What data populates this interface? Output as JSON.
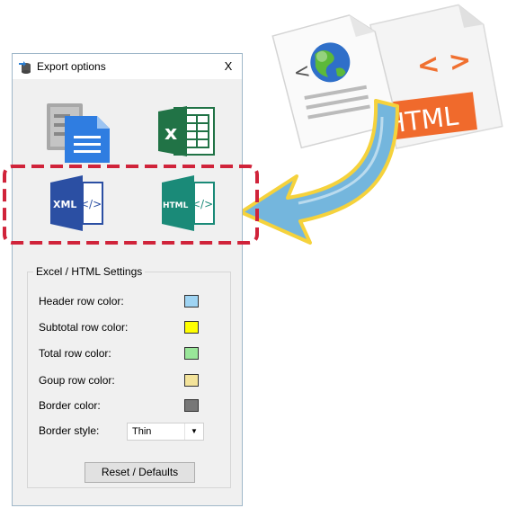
{
  "dialog": {
    "title": "Export options",
    "close_label": "X"
  },
  "export_icons": {
    "word": "Word document",
    "excel": "Excel",
    "xml": {
      "text": "XML",
      "code": "</>"
    },
    "html": {
      "text": "HTML",
      "code": "</>"
    }
  },
  "settings": {
    "group_title": "Excel / HTML Settings",
    "rows": [
      {
        "label": "Header row color:",
        "color": "#9fd4f3"
      },
      {
        "label": "Subtotal row color:",
        "color": "#ffff00"
      },
      {
        "label": "Total row color:",
        "color": "#99e699"
      },
      {
        "label": "Goup row color:",
        "color": "#f3e39a"
      },
      {
        "label": "Border color:",
        "color": "#777777"
      }
    ],
    "border_style_label": "Border style:",
    "border_style_value": "Thin",
    "reset_label": "Reset / Defaults"
  },
  "illustration": {
    "html_badge": "HTML",
    "html_code": "< >",
    "globe_code": "< >"
  },
  "colors": {
    "highlight_dash": "#d0233a",
    "word_blue": "#2b579a",
    "excel_green": "#217346",
    "html_teal": "#1a8a78",
    "arrow_blue": "#5aa9d6",
    "arrow_yellow": "#f5d23c"
  }
}
